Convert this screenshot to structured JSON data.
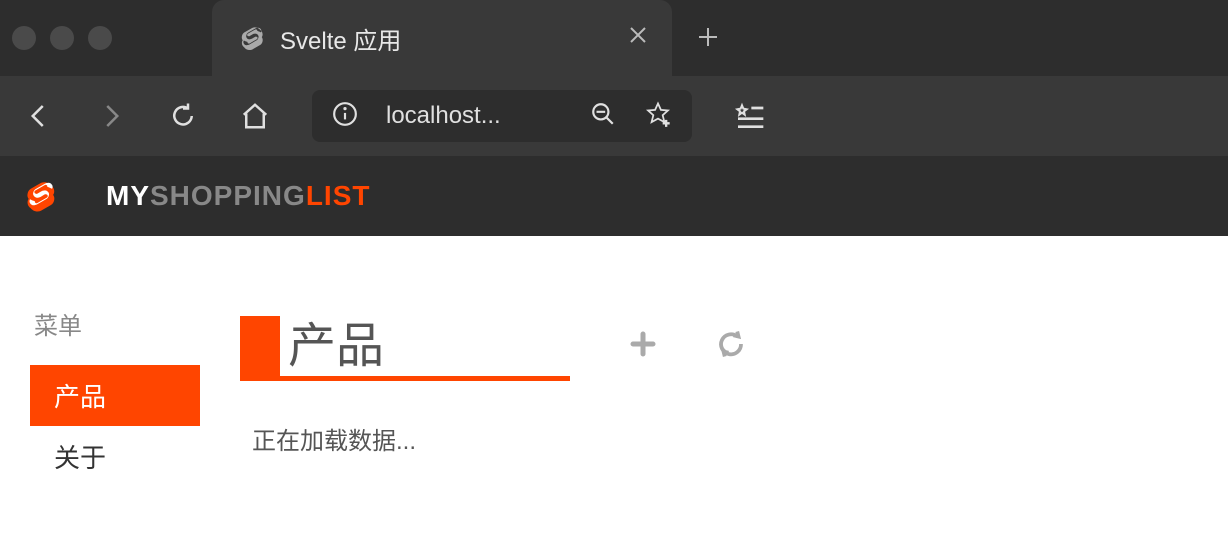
{
  "browser": {
    "tab_title": "Svelte 应用",
    "address": "localhost..."
  },
  "header": {
    "logo": {
      "part1": "MY",
      "part2": "SHOPPING",
      "part3": "LIST"
    }
  },
  "sidebar": {
    "header": "菜单",
    "items": [
      {
        "label": "产品",
        "active": true
      },
      {
        "label": "关于",
        "active": false
      }
    ]
  },
  "main": {
    "title": "产品",
    "loading_text": "正在加载数据..."
  }
}
